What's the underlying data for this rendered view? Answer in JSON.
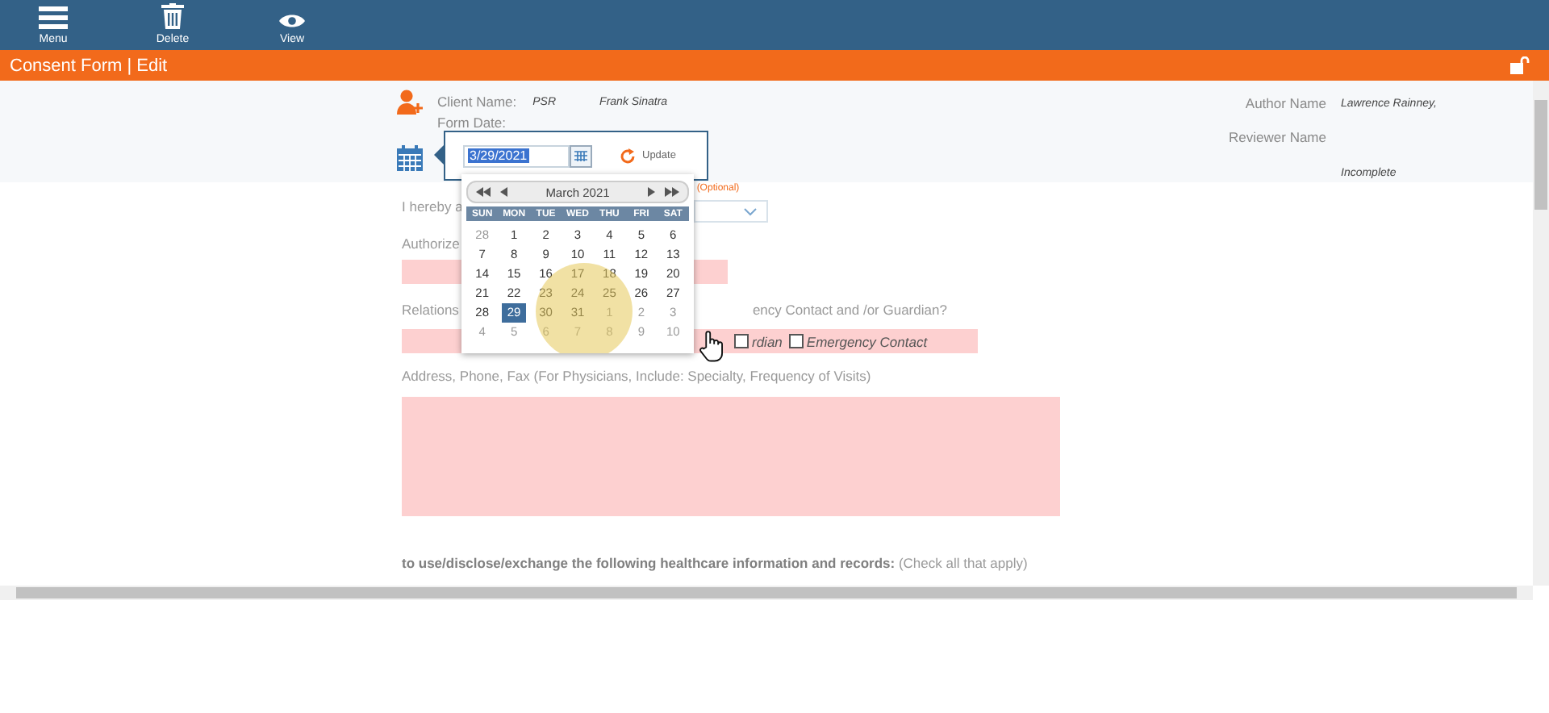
{
  "toolbar": [
    {
      "kind": "menu",
      "label": "Menu"
    },
    {
      "kind": "delete",
      "label": "Delete"
    },
    {
      "kind": "view",
      "label": "View"
    }
  ],
  "title": "Consent Form | Edit",
  "header": {
    "client_name_label": "Client Name:",
    "client_code": "PSR",
    "client_name": "Frank Sinatra",
    "form_date_label": "Form Date:",
    "author_label": "Author Name",
    "author": "Lawrence Rainney,",
    "reviewer_label": "Reviewer Name",
    "status": "Incomplete"
  },
  "date_picker": {
    "value": "3/29/2021",
    "update": "Update"
  },
  "calendar": {
    "month": "March 2021",
    "weekdays": [
      "SUN",
      "MON",
      "TUE",
      "WED",
      "THU",
      "FRI",
      "SAT"
    ],
    "weeks": [
      [
        {
          "day": "28",
          "other_month": true,
          "selected": false
        },
        {
          "day": "1",
          "other_month": false,
          "selected": false
        },
        {
          "day": "2",
          "other_month": false,
          "selected": false
        },
        {
          "day": "3",
          "other_month": false,
          "selected": false
        },
        {
          "day": "4",
          "other_month": false,
          "selected": false
        },
        {
          "day": "5",
          "other_month": false,
          "selected": false
        },
        {
          "day": "6",
          "other_month": false,
          "selected": false
        }
      ],
      [
        {
          "day": "7",
          "other_month": false,
          "selected": false
        },
        {
          "day": "8",
          "other_month": false,
          "selected": false
        },
        {
          "day": "9",
          "other_month": false,
          "selected": false
        },
        {
          "day": "10",
          "other_month": false,
          "selected": false
        },
        {
          "day": "11",
          "other_month": false,
          "selected": false
        },
        {
          "day": "12",
          "other_month": false,
          "selected": false
        },
        {
          "day": "13",
          "other_month": false,
          "selected": false
        }
      ],
      [
        {
          "day": "14",
          "other_month": false,
          "selected": false
        },
        {
          "day": "15",
          "other_month": false,
          "selected": false
        },
        {
          "day": "16",
          "other_month": false,
          "selected": false
        },
        {
          "day": "17",
          "other_month": false,
          "selected": false
        },
        {
          "day": "18",
          "other_month": false,
          "selected": false
        },
        {
          "day": "19",
          "other_month": false,
          "selected": false
        },
        {
          "day": "20",
          "other_month": false,
          "selected": false
        }
      ],
      [
        {
          "day": "21",
          "other_month": false,
          "selected": false
        },
        {
          "day": "22",
          "other_month": false,
          "selected": false
        },
        {
          "day": "23",
          "other_month": false,
          "selected": false
        },
        {
          "day": "24",
          "other_month": false,
          "selected": false
        },
        {
          "day": "25",
          "other_month": false,
          "selected": false
        },
        {
          "day": "26",
          "other_month": false,
          "selected": false
        },
        {
          "day": "27",
          "other_month": false,
          "selected": false
        }
      ],
      [
        {
          "day": "28",
          "other_month": false,
          "selected": false
        },
        {
          "day": "29",
          "other_month": false,
          "selected": true
        },
        {
          "day": "30",
          "other_month": false,
          "selected": false
        },
        {
          "day": "31",
          "other_month": false,
          "selected": false
        },
        {
          "day": "1",
          "other_month": true,
          "selected": false
        },
        {
          "day": "2",
          "other_month": true,
          "selected": false
        },
        {
          "day": "3",
          "other_month": true,
          "selected": false
        }
      ],
      [
        {
          "day": "4",
          "other_month": true,
          "selected": false
        },
        {
          "day": "5",
          "other_month": true,
          "selected": false
        },
        {
          "day": "6",
          "other_month": true,
          "selected": false
        },
        {
          "day": "7",
          "other_month": true,
          "selected": false
        },
        {
          "day": "8",
          "other_month": true,
          "selected": false
        },
        {
          "day": "9",
          "other_month": true,
          "selected": false
        },
        {
          "day": "10",
          "other_month": true,
          "selected": false
        }
      ]
    ]
  },
  "form": {
    "intro": "I hereby a",
    "optional": "(Optional)",
    "authorized_label": "Authorize",
    "relationship_label": "Relations",
    "relationship_question": "ency Contact and /or Guardian?",
    "checkboxes": [
      {
        "label": "rdian",
        "checked": false
      },
      {
        "label": "Emergency Contact",
        "checked": false
      }
    ],
    "address_label": "Address, Phone, Fax (For Physicians, Include: Specialty, Frequency of Visits)",
    "records_text": "**to use/disclose/exchange the following healthcare information and records:** (Check all that apply)"
  }
}
